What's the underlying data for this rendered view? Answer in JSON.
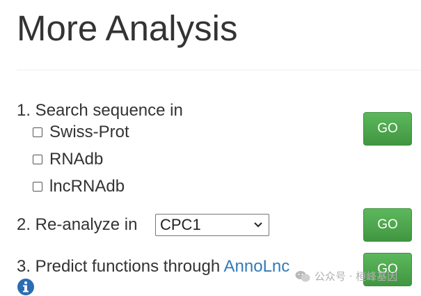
{
  "page": {
    "title": "More Analysis"
  },
  "section1": {
    "label": "1. Search sequence in",
    "options": [
      {
        "label": "Swiss-Prot",
        "checked": false
      },
      {
        "label": "RNAdb",
        "checked": false
      },
      {
        "label": "lncRNAdb",
        "checked": false
      }
    ],
    "go_label": "GO"
  },
  "section2": {
    "label": "2. Re-analyze in",
    "select_value": "CPC1",
    "go_label": "GO"
  },
  "section3": {
    "label": "3. Predict functions through ",
    "link_text": "AnnoLnc",
    "go_label": "GO",
    "info_icon": "info-circle-icon"
  },
  "watermark": {
    "text": "公众号 · 桓峰基因",
    "icon": "wechat-icon"
  },
  "colors": {
    "go_button": "#4cae4c",
    "link": "#337ab7",
    "info_icon": "#2a6db5"
  }
}
